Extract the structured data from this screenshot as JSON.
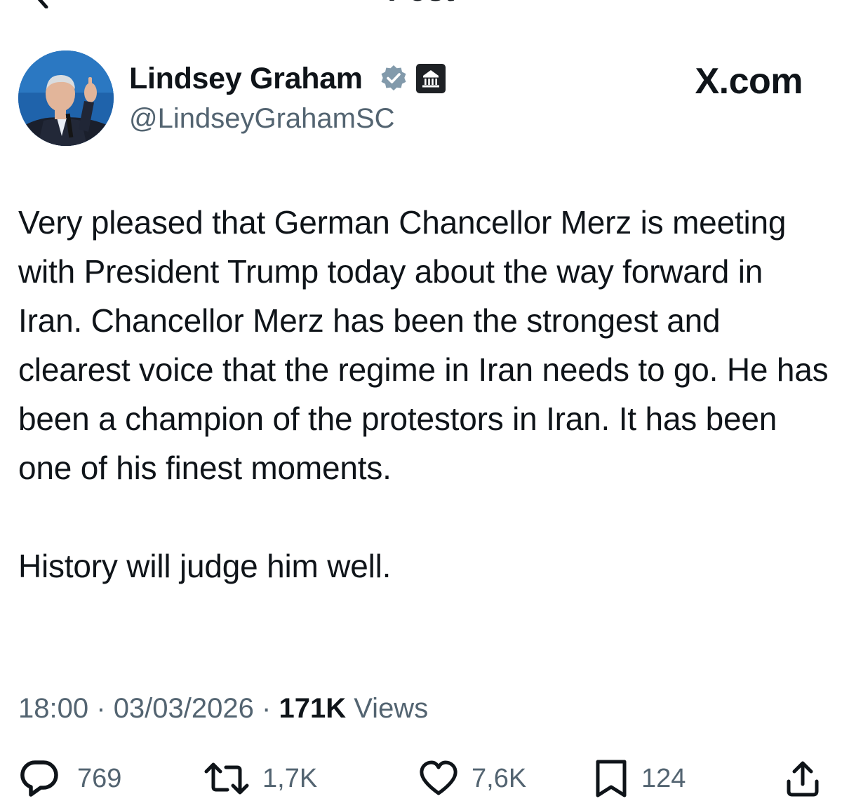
{
  "header": {
    "title": "Post"
  },
  "author": {
    "name": "Lindsey Graham",
    "handle": "@LindseyGrahamSC",
    "verified": true,
    "government_badge": true
  },
  "source_label": "X.com",
  "post": {
    "paragraphs": [
      "Very pleased that German Chancellor Merz is meeting with President Trump today about the way forward in Iran. Chancellor Merz has been the strongest and clearest voice that the regime in Iran needs to go. He has been a champion of the protestors in Iran. It has been one of his finest moments.",
      "History will judge him well."
    ]
  },
  "meta": {
    "time": "18:00",
    "separator": "·",
    "date": "03/03/2026",
    "views_count": "171K",
    "views_label": "Views"
  },
  "actions": {
    "replies": "769",
    "reposts": "1,7K",
    "likes": "7,6K",
    "bookmarks": "124"
  },
  "colors": {
    "text": "#0f1419",
    "secondary": "#536471",
    "verified_gray": "#829aab"
  },
  "icons": [
    "back-arrow-icon",
    "verified-icon",
    "government-icon",
    "reply-icon",
    "repost-icon",
    "like-icon",
    "bookmark-icon",
    "share-icon"
  ]
}
